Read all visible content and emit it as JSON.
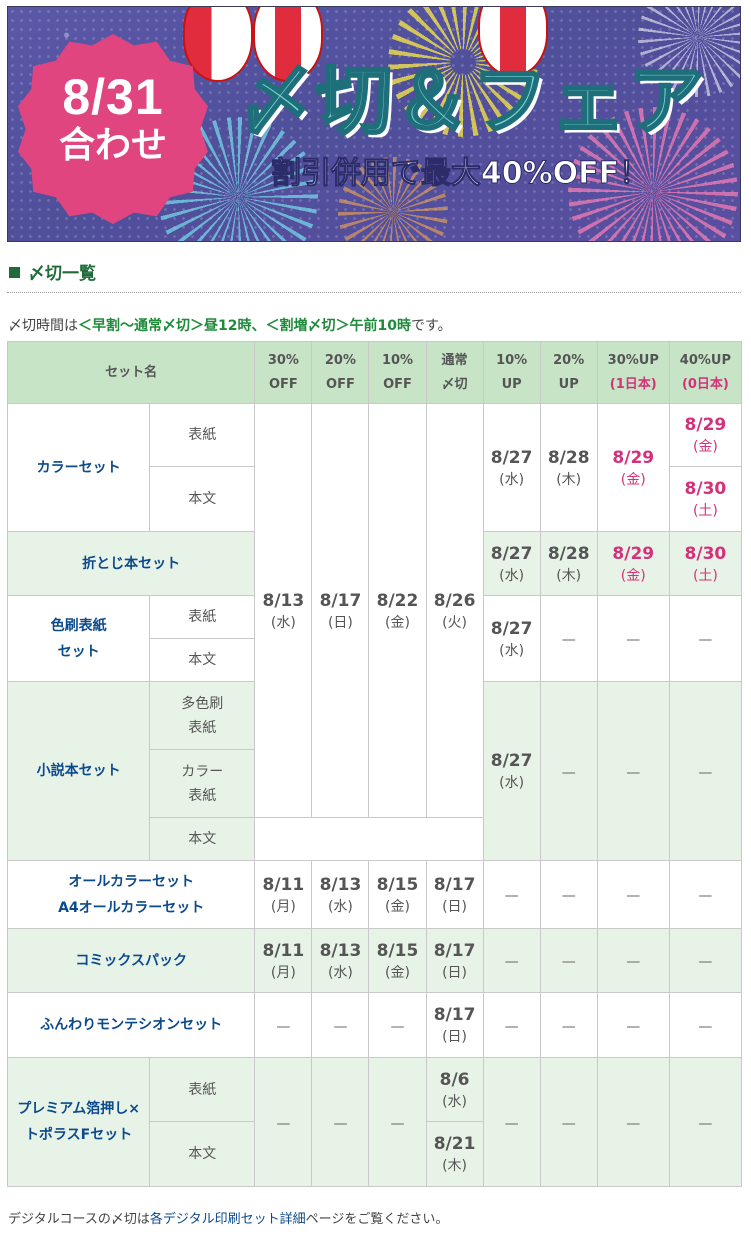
{
  "banner": {
    "badge_date": "8/31",
    "badge_sub": "合わせ",
    "title": "〆切＆フェア",
    "subtitle": "割引併用で最大40%OFF！"
  },
  "heading": "〆切一覧",
  "note": {
    "prefix": "〆切時間は",
    "part1": "＜早割～通常〆切＞昼12時、",
    "part2": "＜割増〆切＞午前10時",
    "suffix": "です。"
  },
  "table": {
    "headers": {
      "set": "セット名",
      "c1": [
        "30%",
        "OFF"
      ],
      "c2": [
        "20%",
        "OFF"
      ],
      "c3": [
        "10%",
        "OFF"
      ],
      "c4": [
        "通常",
        "〆切"
      ],
      "c5": [
        "10%",
        "UP"
      ],
      "c6": [
        "20%",
        "UP"
      ],
      "c7": [
        "30%UP",
        "(1日本)"
      ],
      "c8": [
        "40%UP",
        "(0日本)"
      ]
    },
    "dash": "—",
    "rows": {
      "color_set": {
        "name": "カラーセット",
        "sub1": "表紙",
        "sub2": "本文",
        "c5": [
          "8/27",
          "(水)"
        ],
        "c6": [
          "8/28",
          "(木)"
        ],
        "c7": [
          "8/29",
          "(金)"
        ],
        "c8a": [
          "8/29",
          "(金)"
        ],
        "c8b": [
          "8/30",
          "(土)"
        ]
      },
      "shared_early": {
        "c1": [
          "8/13",
          "(水)"
        ],
        "c2": [
          "8/17",
          "(日)"
        ],
        "c3": [
          "8/22",
          "(金)"
        ],
        "c4": [
          "8/26",
          "(火)"
        ]
      },
      "ori": {
        "name": "折とじ本セット",
        "c5": [
          "8/27",
          "(水)"
        ],
        "c6": [
          "8/28",
          "(木)"
        ],
        "c7": [
          "8/29",
          "(金)"
        ],
        "c8": [
          "8/30",
          "(土)"
        ]
      },
      "iro": {
        "name1": "色刷表紙",
        "name2": "セット",
        "sub1": "表紙",
        "sub2": "本文",
        "c5": [
          "8/27",
          "(水)"
        ]
      },
      "novel": {
        "name": "小説本セット",
        "sub1a": "多色刷",
        "sub1b": "表紙",
        "sub2a": "カラー",
        "sub2b": "表紙",
        "sub3": "本文",
        "c5": [
          "8/27",
          "(水)"
        ]
      },
      "allcolor": {
        "name1": "オールカラーセット",
        "name2": "A4オールカラーセット",
        "c1": [
          "8/11",
          "(月)"
        ],
        "c2": [
          "8/13",
          "(水)"
        ],
        "c3": [
          "8/15",
          "(金)"
        ],
        "c4": [
          "8/17",
          "(日)"
        ]
      },
      "comics": {
        "name": "コミックスパック",
        "c1": [
          "8/11",
          "(月)"
        ],
        "c2": [
          "8/13",
          "(水)"
        ],
        "c3": [
          "8/15",
          "(金)"
        ],
        "c4": [
          "8/17",
          "(日)"
        ]
      },
      "funwari": {
        "name": "ふんわりモンテシオンセット",
        "c4": [
          "8/17",
          "(日)"
        ]
      },
      "premium": {
        "name1": "プレミアム箔押し×",
        "name2": "トポラスFセット",
        "sub1": "表紙",
        "sub2": "本文",
        "c4a": [
          "8/6",
          "(水)"
        ],
        "c4b": [
          "8/21",
          "(木)"
        ]
      }
    }
  },
  "footer": {
    "prefix": "デジタルコースの〆切は",
    "link": "各デジタル印刷セット詳細",
    "suffix": "ページをご覧ください。"
  },
  "colors": {
    "header_bg": "#c7e4c7",
    "alt_row": "#e8f3e8",
    "set_name": "#0b4a8c",
    "pink": "#d4317a",
    "green": "#1f6b3a"
  }
}
